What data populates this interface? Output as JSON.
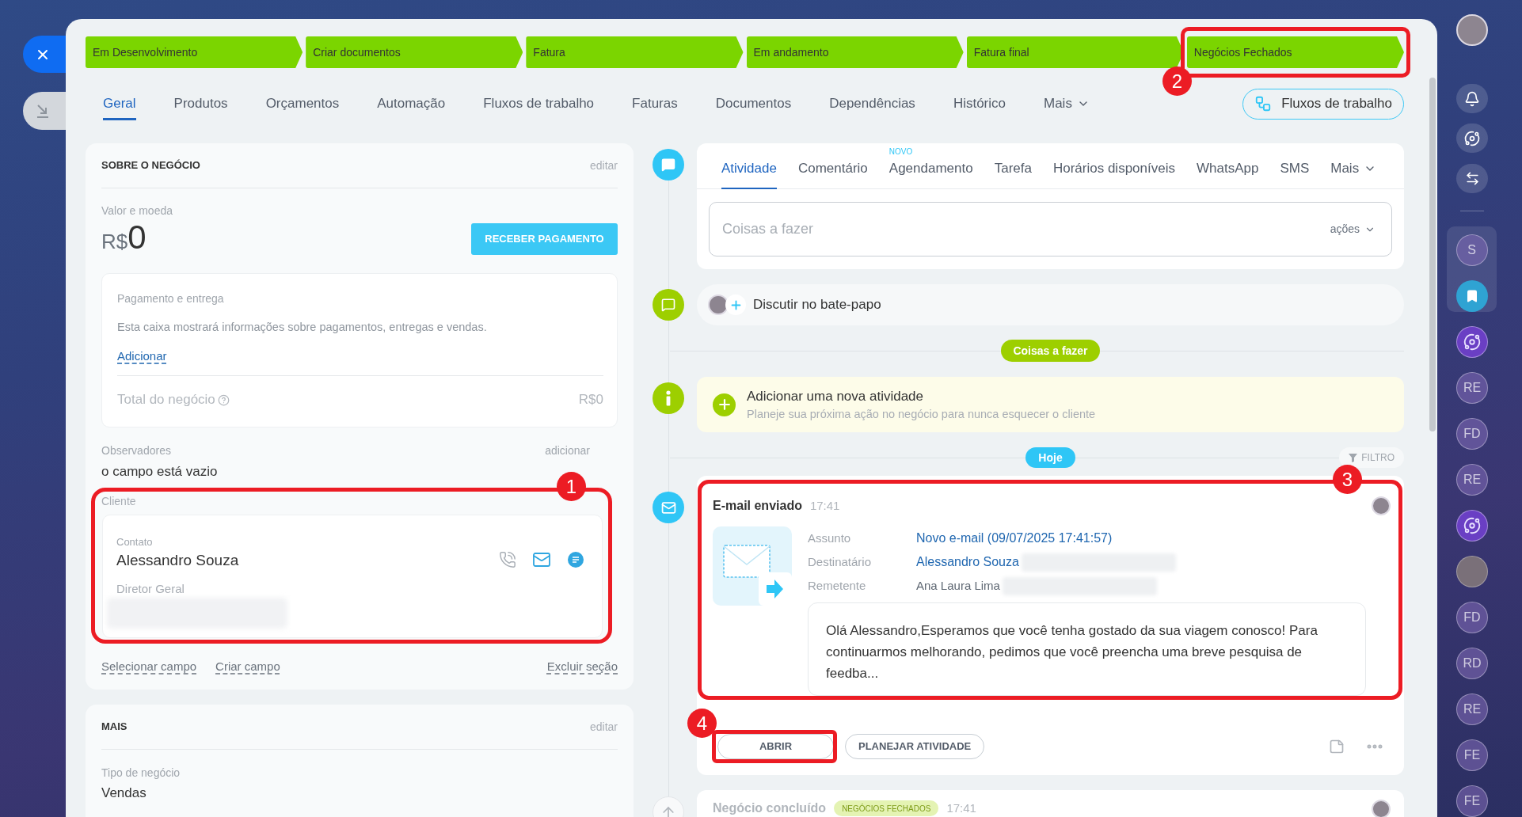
{
  "stages": [
    {
      "label": "Em Desenvolvimento"
    },
    {
      "label": "Criar documentos"
    },
    {
      "label": "Fatura"
    },
    {
      "label": "Em andamento"
    },
    {
      "label": "Fatura final"
    },
    {
      "label": "Negócios Fechados",
      "callout": "2"
    }
  ],
  "tabs": [
    {
      "label": "Geral",
      "kind": "tab",
      "selected": true
    },
    {
      "label": "Produtos",
      "kind": "tab",
      "selected": false
    },
    {
      "label": "Orçamentos",
      "kind": "tab",
      "selected": false
    },
    {
      "label": "Automação",
      "kind": "tab",
      "selected": false
    },
    {
      "label": "Fluxos de trabalho",
      "kind": "tab",
      "selected": false
    },
    {
      "label": "Faturas",
      "kind": "tab",
      "selected": false
    },
    {
      "label": "Documentos",
      "kind": "tab",
      "selected": false
    },
    {
      "label": "Dependências",
      "kind": "tab",
      "selected": false
    },
    {
      "label": "Histórico",
      "kind": "tab",
      "selected": false
    },
    {
      "label": "Mais",
      "kind": "menu",
      "selected": false
    }
  ],
  "workflow_button": {
    "label": "Fluxos de trabalho"
  },
  "deal_section": {
    "title": "SOBRE O NEGÓCIO",
    "edit": "editar",
    "amount_label": "Valor e moeda",
    "currency": "R$",
    "amount": "0",
    "pay_button": "RECEBER PAGAMENTO",
    "payment": {
      "title": "Pagamento e entrega",
      "description": "Esta caixa mostrará informações sobre pagamentos, entregas e vendas.",
      "add_link": "Adicionar",
      "total_label": "Total do negócio",
      "total_value": "R$0"
    },
    "observers": {
      "label": "Observadores",
      "add": "adicionar",
      "value": "o campo está vazio"
    },
    "client": {
      "label": "Cliente",
      "contact_label": "Contato",
      "name": "Alessandro Souza",
      "position": "Diretor Geral",
      "redacted": true,
      "callout": "1"
    },
    "footer": {
      "left_links": [
        "Selecionar campo",
        "Criar campo"
      ],
      "right_link": "Excluir seção"
    }
  },
  "more_section": {
    "title": "MAIS",
    "edit": "editar",
    "fields": [
      {
        "label": "Tipo de negócio",
        "value": "Vendas"
      }
    ]
  },
  "composer": {
    "tabs": [
      {
        "label": "Atividade",
        "kind": "tab",
        "selected": true
      },
      {
        "label": "Comentário",
        "kind": "tab",
        "selected": false
      },
      {
        "label": "Agendamento",
        "kind": "tab",
        "selected": false,
        "badge": "NOVO"
      },
      {
        "label": "Tarefa",
        "kind": "tab",
        "selected": false
      },
      {
        "label": "Horários disponíveis",
        "kind": "tab",
        "selected": false
      },
      {
        "label": "WhatsApp",
        "kind": "tab",
        "selected": false
      },
      {
        "label": "SMS",
        "kind": "tab",
        "selected": false
      },
      {
        "label": "Mais",
        "kind": "menu",
        "selected": false
      }
    ],
    "placeholder": "Coisas a fazer",
    "actions": "ações"
  },
  "chat_bar": {
    "label": "Discutir no bate-papo"
  },
  "todo_divider": {
    "label": "Coisas a fazer"
  },
  "new_activity": {
    "title": "Adicionar uma nova atividade",
    "subtitle": "Planeje sua próxima ação no negócio para nunca esquecer o cliente"
  },
  "today_divider": {
    "label": "Hoje",
    "filter": "FILTRO"
  },
  "email_event": {
    "title": "E-mail enviado",
    "time": "17:41",
    "callout": "3",
    "fields": [
      {
        "label": "Assunto",
        "value": "Novo e-mail (09/07/2025 17:41:57)",
        "kind": "link",
        "redacted": false
      },
      {
        "label": "Destinatário",
        "value": "Alessandro Souza",
        "kind": "link",
        "redacted": true
      },
      {
        "label": "Remetente",
        "value": "Ana Laura Lima",
        "kind": "text",
        "redacted": true
      }
    ],
    "message": "Olá Alessandro,Esperamos que você tenha gostado da sua viagem conosco! Para continuarmos melhorando, pedimos que você preencha uma breve pesquisa de feedba...",
    "buttons": [
      {
        "label": "ABRIR",
        "callout": "4"
      },
      {
        "label": "PLANEJAR ATIVIDADE"
      }
    ]
  },
  "closed_event": {
    "title": "Negócio concluído",
    "badge": "NEGÓCIOS FECHADOS",
    "time": "17:41"
  },
  "rail": {
    "pinned": [
      {
        "kind": "initials",
        "label": "S"
      },
      {
        "kind": "bookmark"
      }
    ],
    "items": [
      {
        "kind": "app"
      },
      {
        "kind": "initials",
        "label": "RE"
      },
      {
        "kind": "initials",
        "label": "FD"
      },
      {
        "kind": "initials",
        "label": "RE"
      },
      {
        "kind": "app"
      },
      {
        "kind": "avatar"
      },
      {
        "kind": "initials",
        "label": "FD"
      },
      {
        "kind": "initials",
        "label": "RD"
      },
      {
        "kind": "initials",
        "label": "RE"
      },
      {
        "kind": "initials",
        "label": "FE"
      },
      {
        "kind": "initials",
        "label": "FE"
      }
    ]
  }
}
